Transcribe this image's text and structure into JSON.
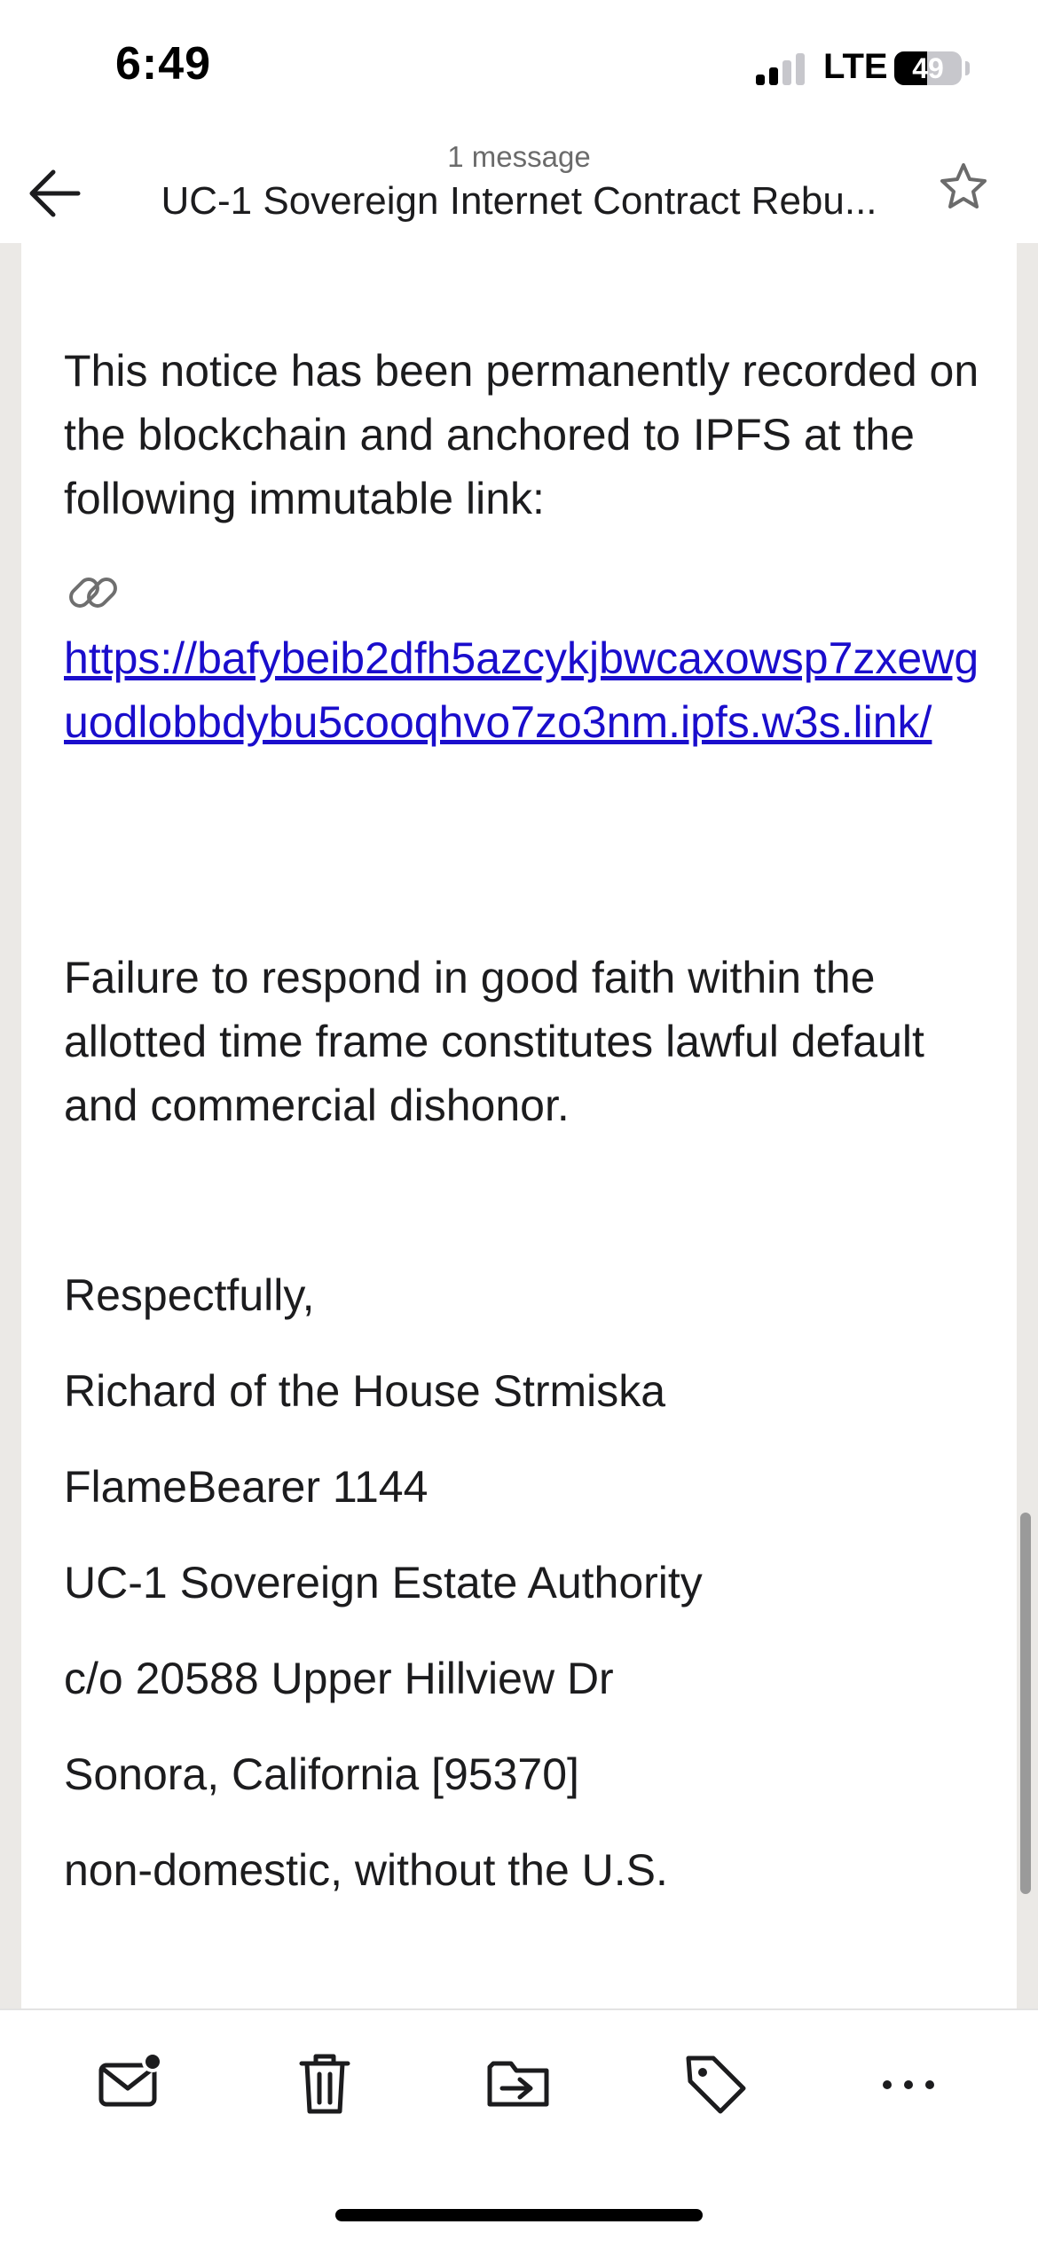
{
  "status_bar": {
    "time": "6:49",
    "network": "LTE",
    "battery": "49",
    "battery_level": 0.49,
    "signal_bars_active": 2,
    "signal_bars_total": 4
  },
  "header": {
    "message_count": "1 message",
    "subject": "UC-1 Sovereign Internet Contract Rebu...",
    "back_icon": "back-arrow-icon",
    "star_icon": "star-outline-icon"
  },
  "body": {
    "paragraph_1": "This notice has been permanently recorded on the blockchain and anchored to IPFS at the following immutable link:",
    "link_emoji": "link-icon",
    "link_url": "https://bafybeib2dfh5azcykjbwcaxowsp7zxewguodlobbdybu5cooqhvo7zo3nm.ipfs.w3s.link/",
    "paragraph_2": "Failure to respond in good faith within the allotted time frame constitutes lawful default and commercial dishonor.",
    "signature": [
      "Respectfully,",
      "Richard of the House Strmiska",
      "FlameBearer 1144",
      "UC-1 Sovereign Estate Authority",
      "c/o 20588 Upper Hillview Dr",
      "Sonora, California [95370]",
      "non-domestic, without the U.S."
    ]
  },
  "toolbar": {
    "icons": [
      "mail-unread-icon",
      "trash-icon",
      "move-folder-icon",
      "tag-icon",
      "more-icon"
    ]
  },
  "colors": {
    "link": "#1a0dcc",
    "text": "#1c1c1e",
    "side_background": "#ebe9e6"
  }
}
